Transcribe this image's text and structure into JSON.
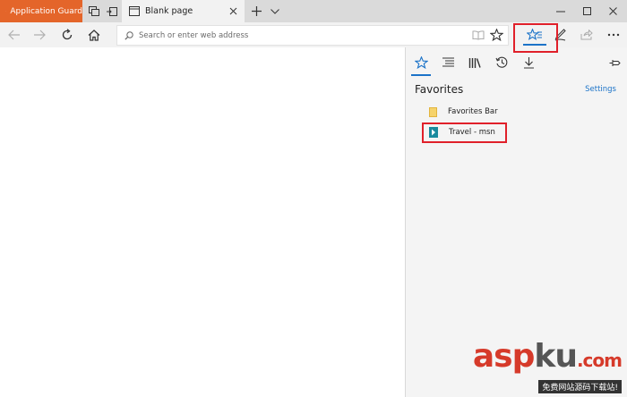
{
  "tabs": {
    "application_guard": "Application Guard",
    "active_tab_title": "Blank page"
  },
  "navbar": {
    "address_placeholder": "Search or enter web address"
  },
  "hub": {
    "title": "Favorites",
    "settings_label": "Settings",
    "items": [
      {
        "label": "Favorites Bar",
        "icon": "folder-icon"
      },
      {
        "label": "Travel - msn",
        "icon": "msn-travel-icon"
      }
    ]
  },
  "colors": {
    "app_guard_orange": "#e4652a",
    "accent_blue": "#1b73c8",
    "highlight_red": "#e0202a"
  },
  "watermark": {
    "logo_part1": "asp",
    "logo_part2": "ku",
    "logo_suffix": ".com",
    "subtitle": "免费网站源码下载站!"
  }
}
